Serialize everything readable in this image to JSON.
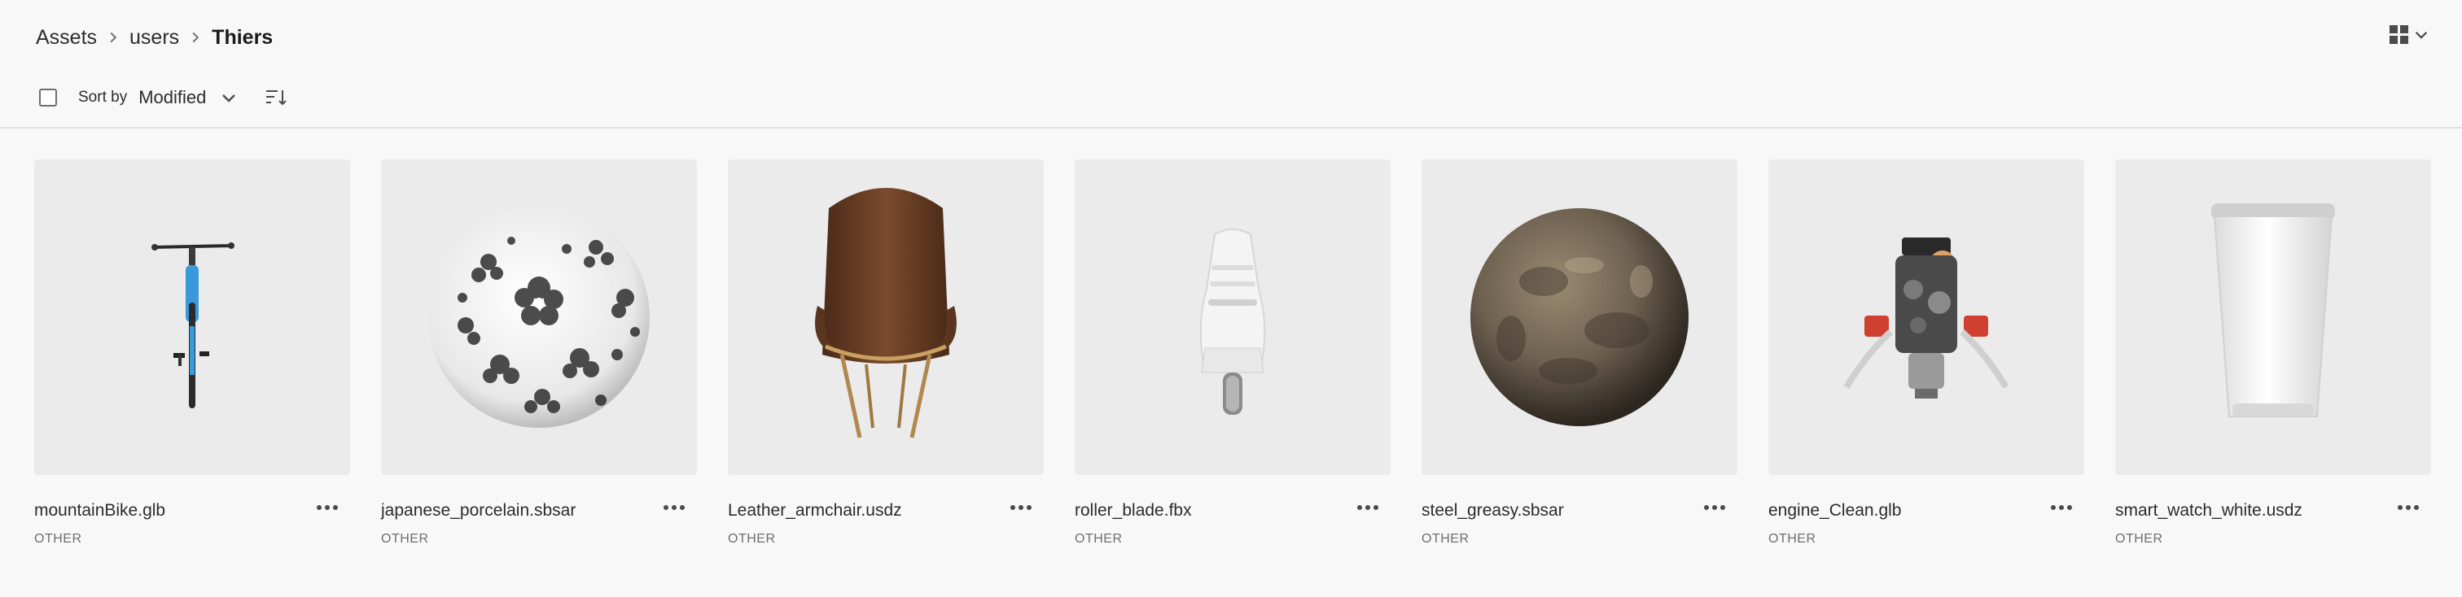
{
  "breadcrumb": {
    "items": [
      "Assets",
      "users"
    ],
    "current": "Thiers"
  },
  "toolbar": {
    "sort_label": "Sort by",
    "sort_value": "Modified"
  },
  "icons": {
    "breadcrumb_separator": "chevron-right-icon",
    "view_toggle": "grid-view-icon",
    "sort_direction": "sort-descending-icon",
    "card_menu": "more-icon"
  },
  "assets": [
    {
      "name": "mountainBike.glb",
      "type": "OTHER",
      "thumbnail": "bike"
    },
    {
      "name": "japanese_porcelain.sbsar",
      "type": "OTHER",
      "thumbnail": "porcelain-sphere"
    },
    {
      "name": "Leather_armchair.usdz",
      "type": "OTHER",
      "thumbnail": "armchair"
    },
    {
      "name": "roller_blade.fbx",
      "type": "OTHER",
      "thumbnail": "roller-blade"
    },
    {
      "name": "steel_greasy.sbsar",
      "type": "OTHER",
      "thumbnail": "steel-sphere"
    },
    {
      "name": "engine_Clean.glb",
      "type": "OTHER",
      "thumbnail": "engine"
    },
    {
      "name": "smart_watch_white.usdz",
      "type": "OTHER",
      "thumbnail": "watch-band"
    }
  ],
  "colors": {
    "background": "#f8f8f8",
    "thumbnail_bg": "#ebebeb",
    "text": "#2c2c2c",
    "muted": "#6e6e6e"
  }
}
